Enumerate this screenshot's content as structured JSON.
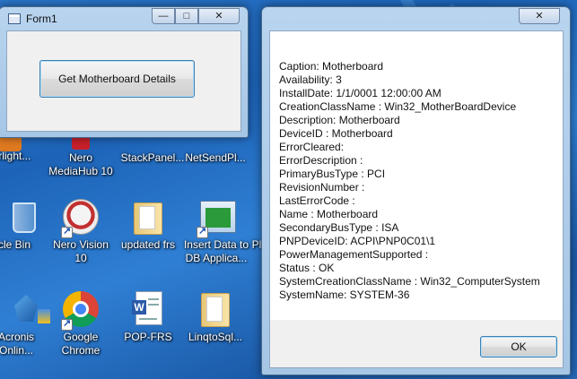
{
  "desktop": {
    "icons": [
      {
        "label": "verlight...",
        "icon": "app-icon-orange"
      },
      {
        "label": "Nero\nMediaHub 10",
        "icon": "nero-mediahub-icon"
      },
      {
        "label": "StackPanel...",
        "icon": "app-icon"
      },
      {
        "label": "NetSendPl...",
        "icon": "app-icon"
      },
      {
        "label": "cycle Bin",
        "icon": "recycle-bin-icon"
      },
      {
        "label": "Nero Vision\n10",
        "icon": "nero-vision-icon"
      },
      {
        "label": "updated frs",
        "icon": "folder-icon"
      },
      {
        "label": "Insert Data to\nDB Applica...",
        "icon": "window-shortcut-icon"
      },
      {
        "label": "Pl",
        "icon": "app-icon"
      },
      {
        "label": "Acronis\nOnlin...",
        "icon": "acronis-icon"
      },
      {
        "label": "Google\nChrome",
        "icon": "chrome-icon"
      },
      {
        "label": "POP-FRS",
        "icon": "word-document-icon"
      },
      {
        "label": "LinqtoSql...",
        "icon": "folder-icon"
      }
    ]
  },
  "form1": {
    "title": "Form1",
    "minimize": "—",
    "maximize": "□",
    "close": "✕",
    "button_label": "Get Motherboard Details"
  },
  "dialog": {
    "close": "✕",
    "ok_label": "OK",
    "lines": [
      "Caption: Motherboard",
      "Availability: 3",
      "InstallDate: 1/1/0001 12:00:00 AM",
      "CreationClassName : Win32_MotherBoardDevice",
      "Description: Motherboard",
      "DeviceID : Motherboard",
      "ErrorCleared:",
      "ErrorDescription :",
      "PrimaryBusType : PCI",
      "RevisionNumber :",
      "LastErrorCode :",
      "Name : Motherboard",
      "SecondaryBusType : ISA",
      "PNPDeviceID: ACPI\\PNP0C01\\1",
      "PowerManagementSupported :",
      "Status : OK",
      "SystemCreationClassName : Win32_ComputerSystem",
      "SystemName: SYSTEM-36"
    ]
  }
}
